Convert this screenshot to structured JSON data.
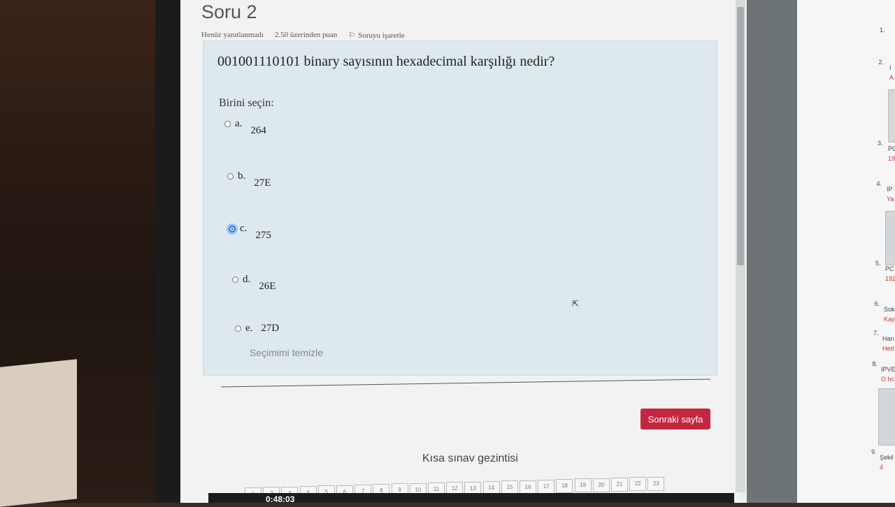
{
  "question": {
    "title": "Soru 2",
    "status": "Henüz yanıtlanmadı",
    "points": "2.50 üzerinden puan",
    "flag_label": "Soruyu işaretle",
    "text": "001001110101 binary sayısının hexadecimal karşılığı nedir?",
    "prompt": "Birini seçin:",
    "options": [
      {
        "letter": "a.",
        "value": "264",
        "selected": false
      },
      {
        "letter": "b.",
        "value": "27E",
        "selected": false
      },
      {
        "letter": "c.",
        "value": "275",
        "selected": true
      },
      {
        "letter": "d.",
        "value": "26E",
        "selected": false
      },
      {
        "letter": "e.",
        "value": "27D",
        "selected": false
      }
    ],
    "clear_label": "Seçimimi temizle"
  },
  "buttons": {
    "next": "Sonraki sayfa"
  },
  "navigation": {
    "title": "Kısa sınav gezintisi",
    "pages": [
      "1",
      "2",
      "3",
      "4",
      "5",
      "6",
      "7",
      "8",
      "9",
      "10",
      "11",
      "12",
      "13",
      "14",
      "15",
      "16",
      "17",
      "18",
      "19",
      "20",
      "21",
      "22",
      "23"
    ]
  },
  "right_panel": {
    "items": [
      {
        "num": "1.",
        "text": "",
        "sub": ""
      },
      {
        "num": "2.",
        "text": "I",
        "sub": "A"
      },
      {
        "num": "3.",
        "text": "PC",
        "sub": "19"
      },
      {
        "num": "4.",
        "text": "IP",
        "sub": "Ya"
      },
      {
        "num": "5.",
        "text": "PC",
        "sub": "192"
      },
      {
        "num": "6.",
        "text": "Sok",
        "sub": "Kay"
      },
      {
        "num": "7.",
        "text": "Han",
        "sub": "Hed"
      },
      {
        "num": "8.",
        "text": "IPVE",
        "sub": "O hc"
      },
      {
        "num": "9.",
        "text": "Şekil",
        "sub": "4"
      }
    ]
  },
  "taskbar": {
    "clock": "0:48:03"
  },
  "colors": {
    "accent": "#c5263f",
    "question_bg": "#dde9ec",
    "selected_radio": "#2f6fd0"
  }
}
